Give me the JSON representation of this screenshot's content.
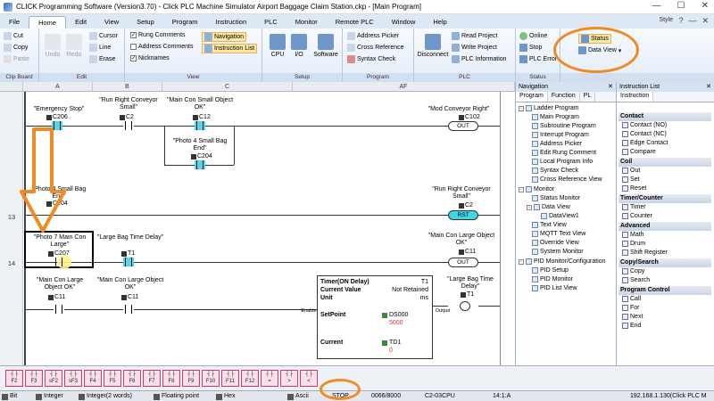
{
  "window": {
    "title": "CLICK Programming Software (Version3.70) - Click PLC Machine Simulator Airport Baggage Claim Station.ckp - [Main Program]"
  },
  "menu": {
    "tabs": [
      "File",
      "Home",
      "Edit",
      "View",
      "Setup",
      "Program",
      "Instruction",
      "PLC",
      "Monitor",
      "Remote PLC",
      "Window",
      "Help"
    ],
    "active_tab": "Home",
    "style_label": "Style"
  },
  "ribbon": {
    "clipboard": {
      "cut": "Cut",
      "copy": "Copy",
      "paste": "Paste",
      "label": "Clip Board"
    },
    "edit": {
      "undo": "Undo",
      "redo": "Redo",
      "cursor": "Cursor",
      "line": "Line",
      "erase": "Erase",
      "label": "Edit"
    },
    "view": {
      "rung_comments": "Rung Comments",
      "address_comments": "Address Comments",
      "nicknames": "Nicknames",
      "navigation": "Navigation",
      "instruction_list": "Instruction List",
      "label": "View"
    },
    "setup": {
      "cpu": "CPU",
      "io": "I/O",
      "software": "Software",
      "label": "Setup"
    },
    "program": {
      "address_picker": "Address Picker",
      "cross_reference": "Cross Reference",
      "syntax_check": "Syntax Check",
      "label": "Program"
    },
    "plc": {
      "disconnect": "Disconnect",
      "read_project": "Read Project",
      "write_project": "Write Project",
      "plc_information": "PLC Information",
      "label": "PLC"
    },
    "status": {
      "online": "Online",
      "stop": "Stop",
      "plc_error": "PLC Error",
      "label": "Status"
    },
    "monitor": {
      "status": "Status",
      "data_view": "Data View"
    }
  },
  "columns": [
    "A",
    "B",
    "C",
    "AF"
  ],
  "rungs": {
    "numbers": [
      "13",
      "14"
    ],
    "contacts": {
      "emergency_stop": {
        "nick": "\"Emergency Stop\"",
        "addr": "C206"
      },
      "run_right_small": {
        "nick": "\"Run Right Conveyor Small\"",
        "addr": "C2"
      },
      "main_con_small_ok": {
        "nick": "\"Main Con Small Object OK\"",
        "addr": "C12"
      },
      "photo4_small_end": {
        "nick": "\"Photo 4 Small Bag End\"",
        "addr": "C204"
      },
      "photo4_small_end2": {
        "nick": "\"Photo 4 Small Bag End\"",
        "addr": "C204"
      },
      "photo7_main_large": {
        "nick": "\"Photo 7 Main Con Large\"",
        "addr": "C207"
      },
      "large_bag_time_delay": {
        "nick": "\"Large Bag Time Delay\"",
        "addr": "T1"
      },
      "main_con_large_ok": {
        "nick": "\"Main Con Large Object OK\"",
        "addr": "C11"
      },
      "main_con_large_ok2": {
        "nick": "\"Main Con Large Object OK\"",
        "addr": "C11"
      }
    },
    "coils": {
      "mod_conveyor_right": {
        "nick": "\"Mod Conveyor Right\"",
        "addr": "C102",
        "type": "OUT"
      },
      "run_right_small": {
        "nick": "\"Run Right Conveyor Small\"",
        "addr": "C2",
        "type": "RST"
      },
      "main_con_large_ok": {
        "nick": "\"Main Con Large Object OK\"",
        "addr": "C11",
        "type": "OUT"
      },
      "large_bag_time_delay": {
        "nick": "\"Large Bag Time Delay\"",
        "addr": "T1",
        "type": ""
      }
    },
    "timer": {
      "title": "Timer(ON Delay)",
      "id": "T1",
      "current_value": "Current Value",
      "retained": "Not Retained",
      "unit": "Unit",
      "unit_val": "ms",
      "enable": "Enable",
      "setpoint": "SetPoint",
      "setpoint_addr": "DS000",
      "setpoint_val": "5000",
      "current": "Current",
      "current_addr": "TD1",
      "current_val": "0",
      "output": "Output"
    }
  },
  "navigation": {
    "title": "Navigation",
    "tabs": [
      "Program",
      "Function",
      "PL"
    ],
    "items": [
      "Ladder Program",
      "Main Program",
      "Subroutine Program",
      "Interrupt Program",
      "Address Picker",
      "Edit Rung Comment",
      "Local Program Info",
      "Syntax Check",
      "Cross Reference View",
      "Monitor",
      "Status Monitor",
      "Data View",
      "DataView1",
      "Text View",
      "MQTT Text View",
      "Override View",
      "System Monitor",
      "PID Monitor/Configuration",
      "PID Setup",
      "PID Monitor",
      "PID List View"
    ]
  },
  "instruction_list": {
    "title": "Instruction List",
    "tab": "Instruction",
    "groups": [
      {
        "name": "Contact",
        "items": [
          "Contact (NO)",
          "Contact (NC)",
          "Edge Contact",
          "Compare"
        ]
      },
      {
        "name": "Coil",
        "items": [
          "Out",
          "Set",
          "Reset"
        ]
      },
      {
        "name": "Timer/Counter",
        "items": [
          "Timer",
          "Counter"
        ]
      },
      {
        "name": "Advanced",
        "items": [
          "Math",
          "Drum",
          "Shift Register"
        ]
      },
      {
        "name": "Copy/Search",
        "items": [
          "Copy",
          "Search"
        ]
      },
      {
        "name": "Program Control",
        "items": [
          "Call",
          "For",
          "Next",
          "End"
        ]
      }
    ]
  },
  "function_keys": [
    "F2",
    "F3",
    "sF2",
    "sF3",
    "F4",
    "F5",
    "F6",
    "F7",
    "F8",
    "F9",
    "F10",
    "F11",
    "F12",
    "=",
    ">",
    "<"
  ],
  "statusbar": {
    "bit": "Bit",
    "integer": "Integer",
    "integer2": "Integer(2 words)",
    "float": "Floating point",
    "hex": "Hex",
    "ascii": "Ascii",
    "mode": "STOP",
    "mem": "0066/8000",
    "cpu": "C2-03CPU",
    "zoom": "14:1:A",
    "conn": "192.168.1.130(Click PLC M"
  },
  "colors": {
    "accent_orange": "#f08a24",
    "energized": "#3fd6e6"
  }
}
